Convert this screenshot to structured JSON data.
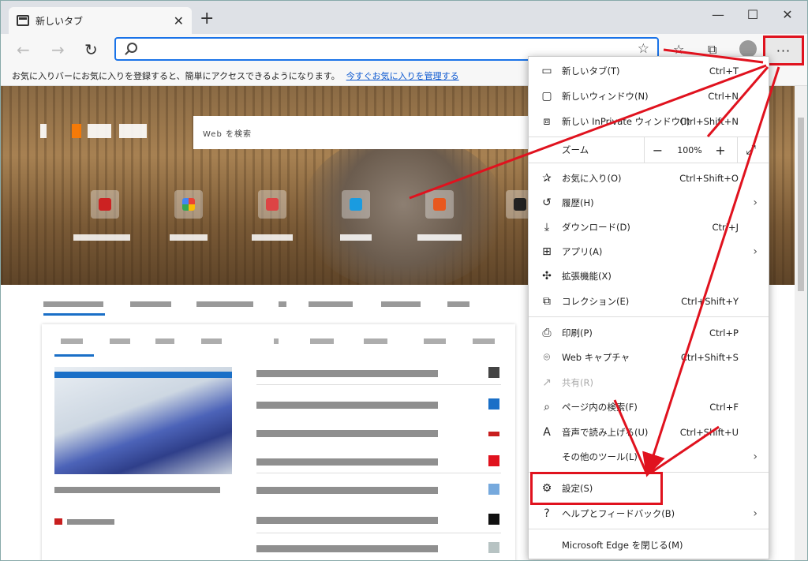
{
  "browser": {
    "tab_title": "新しいタブ",
    "tab_close": "✕",
    "new_tab": "+",
    "window_controls": {
      "minimize": "—",
      "maximize": "☐",
      "close": "✕"
    },
    "icons": [
      "back-icon",
      "forward-icon",
      "reload-icon",
      "search-icon",
      "star-icon",
      "favorites-icon",
      "collections-icon",
      "profile-icon",
      "more-icon"
    ]
  },
  "toolbar": {
    "back": "←",
    "forward": "→",
    "reload": "↻",
    "address_placeholder": "",
    "favorite_star": "☆",
    "favorites": "☆",
    "collections": "⧉",
    "more": "···"
  },
  "favbar": {
    "message": "お気に入りバーにお気に入りを登録すると、簡単にアクセスできるようになります。",
    "link": "今すぐお気に入りを管理する"
  },
  "newtab": {
    "search_placeholder": "Web を検索"
  },
  "menu": {
    "items": [
      {
        "icon": "new-tab-icon",
        "glyph": "▭",
        "label": "新しいタブ(T)",
        "shortcut": "Ctrl+T"
      },
      {
        "icon": "new-window-icon",
        "glyph": "▢",
        "label": "新しいウィンドウ(N)",
        "shortcut": "Ctrl+N"
      },
      {
        "icon": "inprivate-icon",
        "glyph": "⧈",
        "label": "新しい InPrivate ウィンドウ(I)",
        "shortcut": "Ctrl+Shift+N"
      },
      {
        "icon": "favorites-icon",
        "glyph": "✰",
        "label": "お気に入り(O)",
        "shortcut": "Ctrl+Shift+O"
      },
      {
        "icon": "history-icon",
        "glyph": "↺",
        "label": "履歴(H)",
        "shortcut": ""
      },
      {
        "icon": "download-icon",
        "glyph": "⤓",
        "label": "ダウンロード(D)",
        "shortcut": "Ctrl+J"
      },
      {
        "icon": "apps-icon",
        "glyph": "⊞",
        "label": "アプリ(A)",
        "shortcut": ""
      },
      {
        "icon": "extensions-icon",
        "glyph": "✣",
        "label": "拡張機能(X)",
        "shortcut": ""
      },
      {
        "icon": "collections-icon",
        "glyph": "⧉",
        "label": "コレクション(E)",
        "shortcut": "Ctrl+Shift+Y"
      },
      {
        "icon": "print-icon",
        "glyph": "⎙",
        "label": "印刷(P)",
        "shortcut": "Ctrl+P"
      },
      {
        "icon": "web-capture-icon",
        "glyph": "⌾",
        "label": "Web キャプチャ",
        "shortcut": "Ctrl+Shift+S"
      },
      {
        "icon": "share-icon",
        "glyph": "↗",
        "label": "共有(R)",
        "shortcut": ""
      },
      {
        "icon": "find-icon",
        "glyph": "⌕",
        "label": "ページ内の検索(F)",
        "shortcut": "Ctrl+F"
      },
      {
        "icon": "read-aloud-icon",
        "glyph": "A",
        "label": "音声で読み上げる(U)",
        "shortcut": "Ctrl+Shift+U"
      },
      {
        "icon": "",
        "glyph": "",
        "label": "その他のツール(L)",
        "shortcut": ""
      },
      {
        "icon": "settings-icon",
        "glyph": "⚙",
        "label": "設定(S)",
        "shortcut": ""
      },
      {
        "icon": "help-icon",
        "glyph": "?",
        "label": "ヘルプとフィードバック(B)",
        "shortcut": ""
      },
      {
        "icon": "",
        "glyph": "",
        "label": "Microsoft Edge を閉じる(M)",
        "shortcut": ""
      }
    ],
    "zoom": {
      "label": "ズーム",
      "minus": "−",
      "value": "100%",
      "plus": "+",
      "fullscreen": "⤢"
    },
    "chevron": "›"
  },
  "colors": {
    "annotation_red": "#e0121e",
    "accent_blue": "#1a73e8"
  }
}
